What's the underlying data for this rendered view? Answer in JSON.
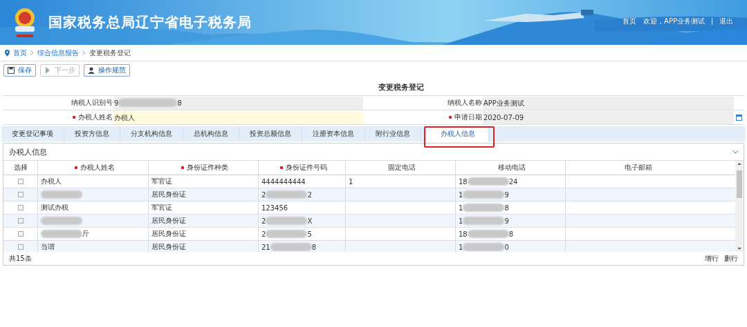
{
  "header": {
    "title": "国家税务总局辽宁省电子税务局",
    "links": [
      {
        "label": "首页"
      },
      {
        "label": "欢迎，APP业务测试"
      },
      {
        "label": "退出"
      }
    ]
  },
  "breadcrumb": [
    {
      "label": "首页",
      "link": true
    },
    {
      "label": "综合信息报告",
      "link": true
    },
    {
      "label": "变更税务登记",
      "link": false
    }
  ],
  "toolbar": [
    {
      "label": "保存",
      "kind": "save",
      "disabled": false
    },
    {
      "label": "下一步",
      "kind": "next",
      "disabled": true
    },
    {
      "label": "操作规范",
      "kind": "guide",
      "disabled": false
    }
  ],
  "form": {
    "title": "变更税务登记",
    "rows": [
      [
        {
          "label": "纳税人识别号",
          "required": false,
          "value": {
            "parts": [
              "9",
              "8"
            ]
          },
          "editable": false
        },
        {
          "label": "纳税人名称",
          "required": false,
          "value": {
            "parts": [
              "APP业务测试"
            ]
          },
          "editable": false
        }
      ],
      [
        {
          "label": "办税人姓名",
          "required": true,
          "value": {
            "parts": [
              "办税人"
            ]
          },
          "editable": true
        },
        {
          "label": "申请日期",
          "required": true,
          "value": {
            "parts": [
              "2020-07-09"
            ]
          },
          "editable": false,
          "kind": "date"
        }
      ]
    ]
  },
  "tabs": [
    {
      "label": "变更登记事项",
      "selected": false
    },
    {
      "label": "投资方信息",
      "selected": false
    },
    {
      "label": "分支机构信息",
      "selected": false
    },
    {
      "label": "总机构信息",
      "selected": false
    },
    {
      "label": "投资总额信息",
      "selected": false
    },
    {
      "label": "注册资本信息",
      "selected": false
    },
    {
      "label": "附行业信息",
      "selected": false
    },
    {
      "label": "办税人信息",
      "selected": true,
      "highlighted": true
    }
  ],
  "panel": {
    "title": "办税人信息",
    "expanded": true,
    "table": {
      "columns": [
        {
          "label": "选择",
          "required": false
        },
        {
          "label": "办税人姓名",
          "required": true
        },
        {
          "label": "身份证件种类",
          "required": true
        },
        {
          "label": "身份证件号码",
          "required": true
        },
        {
          "label": "固定电话",
          "required": false
        },
        {
          "label": "移动电话",
          "required": false
        },
        {
          "label": "电子邮箱",
          "required": false
        }
      ],
      "rows": [
        {
          "cells": [
            {
              "checked": false
            },
            {
              "parts": [
                "办税人"
              ]
            },
            {
              "parts": [
                "军官证"
              ]
            },
            {
              "parts": [
                "4444444444"
              ]
            },
            {
              "parts": [
                "1"
              ]
            },
            {
              "parts": [
                "18",
                "24"
              ]
            },
            {}
          ]
        },
        {
          "cells": [
            {
              "checked": false
            },
            {
              "redacted": true
            },
            {
              "parts": [
                "居民身份证"
              ]
            },
            {
              "parts": [
                "2",
                "2"
              ]
            },
            {},
            {
              "parts": [
                "1",
                "9"
              ]
            },
            {}
          ]
        },
        {
          "cells": [
            {
              "checked": false
            },
            {
              "parts": [
                "测试办税"
              ]
            },
            {
              "parts": [
                "军官证"
              ]
            },
            {
              "parts": [
                "123456"
              ]
            },
            {},
            {
              "parts": [
                "1",
                "8"
              ]
            },
            {}
          ]
        },
        {
          "cells": [
            {
              "checked": false
            },
            {
              "redacted": true
            },
            {
              "parts": [
                "居民身份证"
              ]
            },
            {
              "parts": [
                "2",
                "X"
              ]
            },
            {},
            {
              "parts": [
                "1",
                "9"
              ]
            },
            {}
          ]
        },
        {
          "cells": [
            {
              "checked": false
            },
            {
              "redacted": true,
              "parts": [
                "斤"
              ]
            },
            {
              "parts": [
                "居民身份证"
              ]
            },
            {
              "parts": [
                "2",
                "5"
              ]
            },
            {},
            {
              "parts": [
                "18",
                "8"
              ]
            },
            {}
          ]
        },
        {
          "cells": [
            {
              "checked": false
            },
            {
              "parts": [
                "当谓"
              ]
            },
            {
              "parts": [
                "居民身份证"
              ]
            },
            {
              "parts": [
                "21",
                "8"
              ]
            },
            {},
            {
              "parts": [
                "1",
                "0"
              ]
            },
            {}
          ]
        }
      ]
    },
    "total": "共15条",
    "actions": [
      {
        "label": "增行"
      },
      {
        "label": "删行"
      }
    ]
  }
}
